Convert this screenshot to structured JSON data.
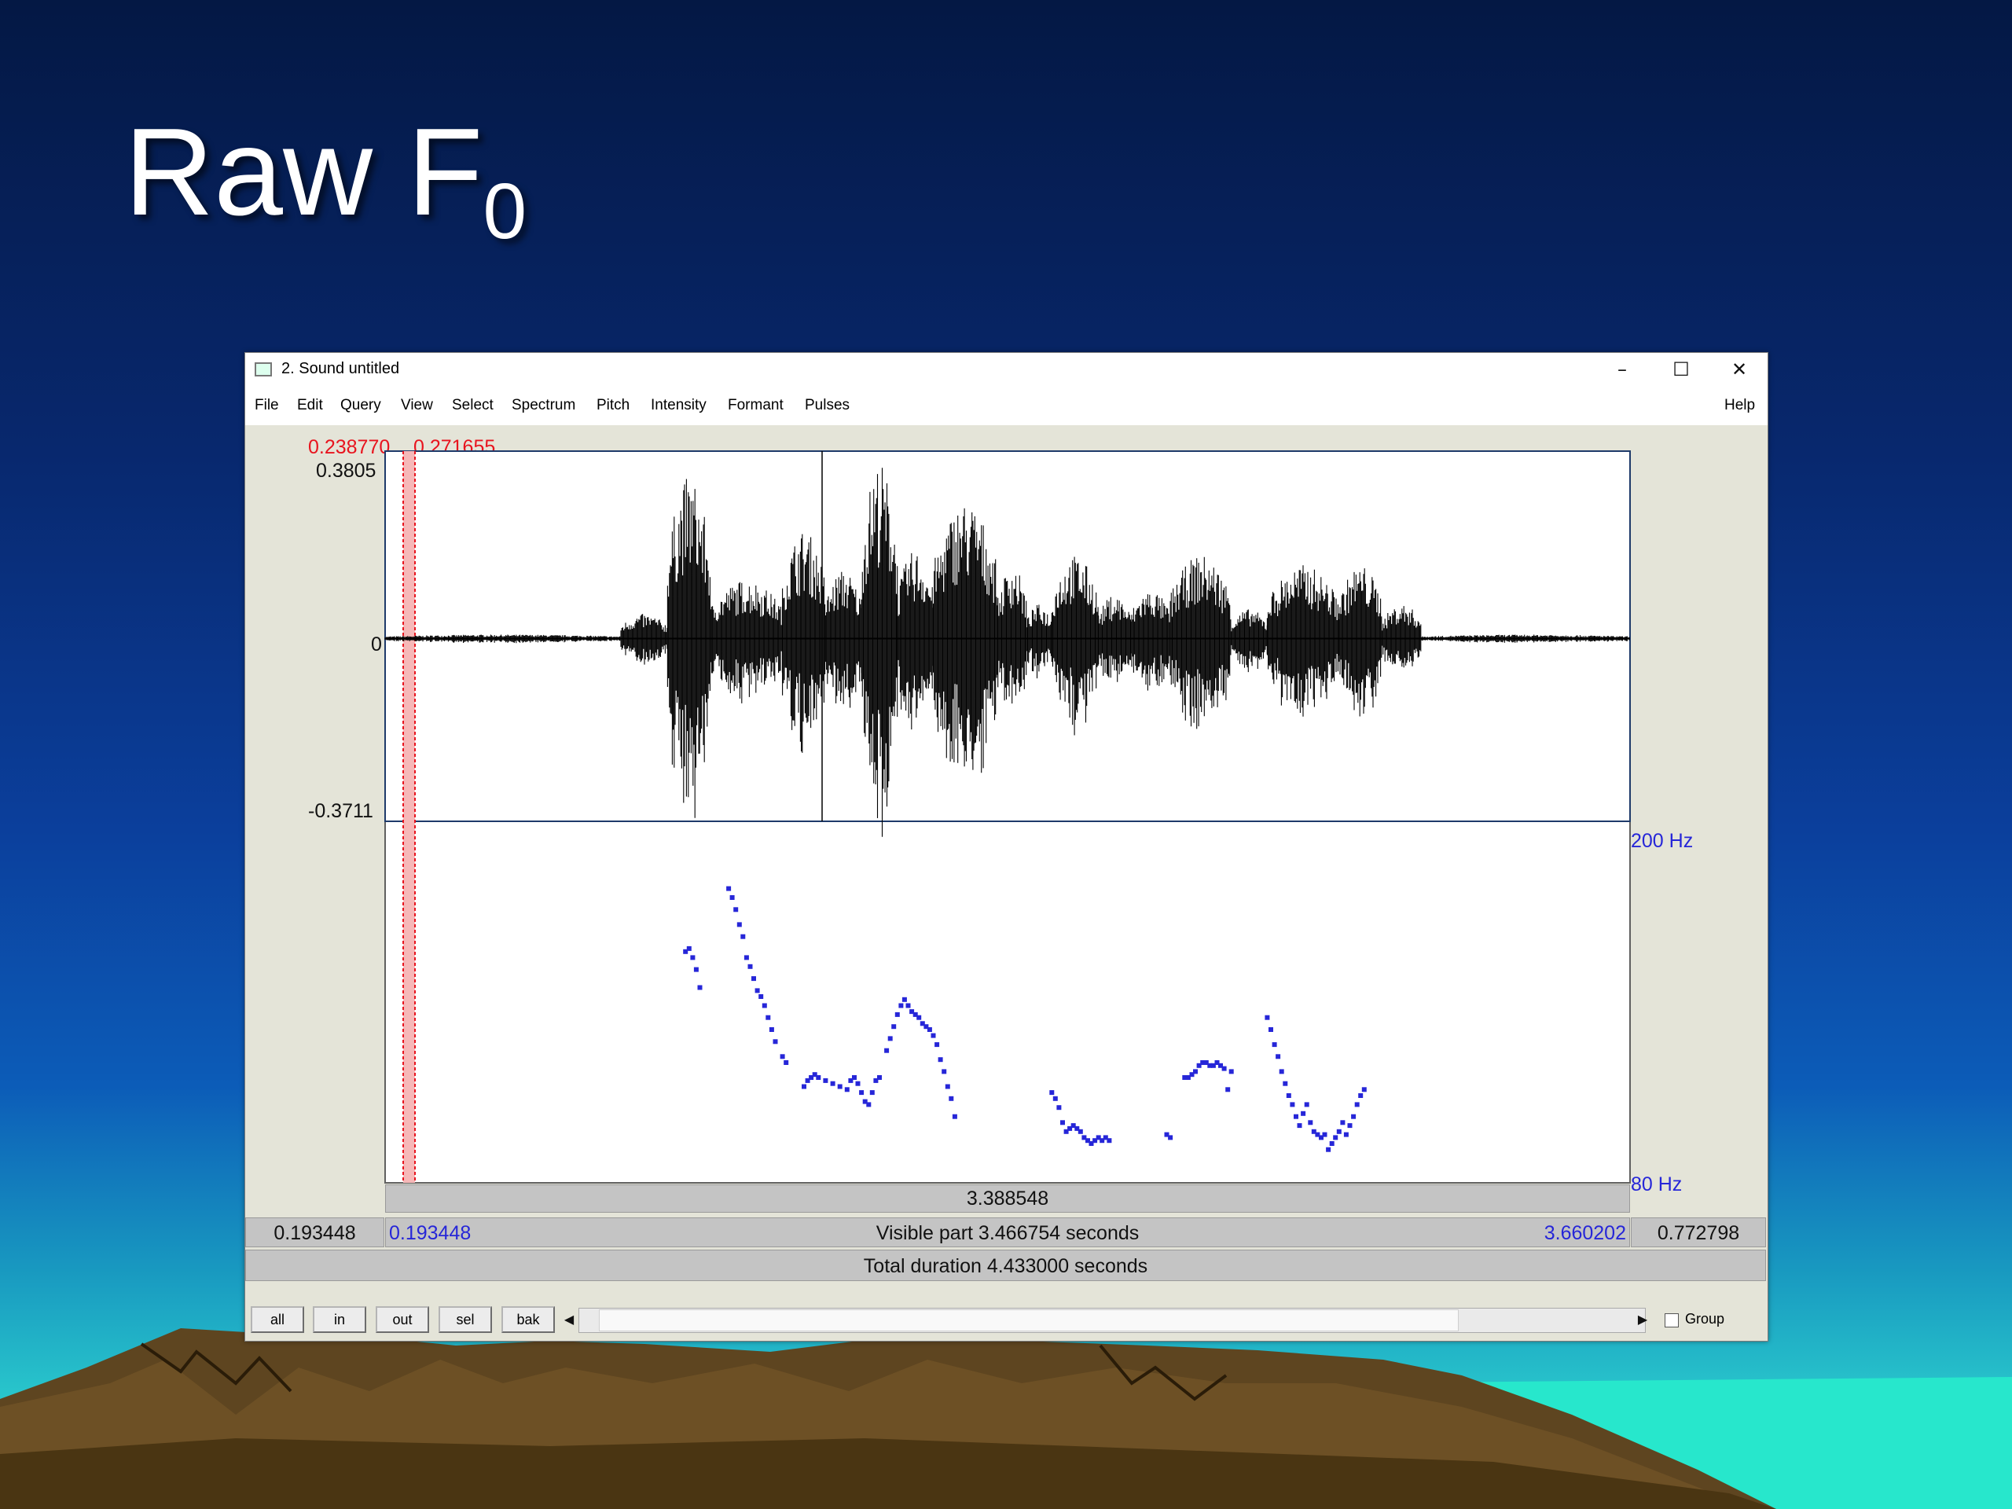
{
  "slide": {
    "title_main": "Raw F",
    "title_sub": "0"
  },
  "window": {
    "title": "2. Sound untitled",
    "controls": {
      "minimize": "–",
      "maximize": "☐",
      "close": "✕"
    },
    "menu": [
      "File",
      "Edit",
      "Query",
      "View",
      "Select",
      "Spectrum",
      "Pitch",
      "Intensity",
      "Formant",
      "Pulses"
    ],
    "help": "Help"
  },
  "editor": {
    "selection_start": "0.238770",
    "selection_end": "0.271655",
    "amplitude_max": "0.3805",
    "amplitude_zero": "0",
    "amplitude_min": "-0.3711",
    "pitch_ceiling": "200 Hz",
    "pitch_floor": "80 Hz",
    "cursor_bar_value": "3.388548",
    "window_left": "0.193448",
    "visible_start": "0.193448",
    "visible_part": "Visible part 3.466754 seconds",
    "visible_end": "3.660202",
    "window_right": "0.772798",
    "total_duration": "Total duration 4.433000 seconds"
  },
  "buttons": {
    "all": "all",
    "in": "in",
    "out": "out",
    "sel": "sel",
    "bak": "bak"
  },
  "group_label": "Group",
  "colors": {
    "selection": "#e8141e",
    "pitch": "#2626d8",
    "waveform": "#000000"
  },
  "chart_data": {
    "type": "scatter",
    "title": "",
    "xlabel": "",
    "ylabel": "",
    "xlim": [
      0.193448,
      3.660202
    ],
    "ylim": [
      80,
      200
    ],
    "waveform": {
      "ylim": [
        -0.3711,
        0.3805
      ],
      "segments": [
        {
          "x0": 0.193448,
          "x1": 0.85,
          "amp": 0.008
        },
        {
          "x0": 0.85,
          "x1": 0.98,
          "amp": 0.05
        },
        {
          "x0": 0.98,
          "x1": 1.1,
          "amp": 0.33
        },
        {
          "x0": 1.1,
          "x1": 1.3,
          "amp": 0.12
        },
        {
          "x0": 1.3,
          "x1": 1.42,
          "amp": 0.22
        },
        {
          "x0": 1.42,
          "x1": 1.52,
          "amp": 0.14
        },
        {
          "x0": 1.52,
          "x1": 1.62,
          "amp": 0.36
        },
        {
          "x0": 1.62,
          "x1": 1.72,
          "amp": 0.18
        },
        {
          "x0": 1.72,
          "x1": 1.9,
          "amp": 0.28
        },
        {
          "x0": 1.9,
          "x1": 1.98,
          "amp": 0.15
        },
        {
          "x0": 1.98,
          "x1": 2.05,
          "amp": 0.07
        },
        {
          "x0": 2.05,
          "x1": 2.18,
          "amp": 0.17
        },
        {
          "x0": 2.18,
          "x1": 2.27,
          "amp": 0.09
        },
        {
          "x0": 2.27,
          "x1": 2.38,
          "amp": 0.1
        },
        {
          "x0": 2.38,
          "x1": 2.55,
          "amp": 0.17
        },
        {
          "x0": 2.55,
          "x1": 2.65,
          "amp": 0.06
        },
        {
          "x0": 2.65,
          "x1": 2.85,
          "amp": 0.15
        },
        {
          "x0": 2.85,
          "x1": 2.97,
          "amp": 0.15
        },
        {
          "x0": 2.97,
          "x1": 3.08,
          "amp": 0.07
        },
        {
          "x0": 3.08,
          "x1": 3.660202,
          "amp": 0.008
        }
      ]
    },
    "pitch_points": [
      {
        "x": 1.03,
        "y": 155
      },
      {
        "x": 1.04,
        "y": 156
      },
      {
        "x": 1.05,
        "y": 153
      },
      {
        "x": 1.06,
        "y": 149
      },
      {
        "x": 1.07,
        "y": 143
      },
      {
        "x": 1.15,
        "y": 176
      },
      {
        "x": 1.16,
        "y": 173
      },
      {
        "x": 1.17,
        "y": 169
      },
      {
        "x": 1.18,
        "y": 164
      },
      {
        "x": 1.19,
        "y": 160
      },
      {
        "x": 1.2,
        "y": 153
      },
      {
        "x": 1.21,
        "y": 150
      },
      {
        "x": 1.22,
        "y": 146
      },
      {
        "x": 1.23,
        "y": 142
      },
      {
        "x": 1.24,
        "y": 140
      },
      {
        "x": 1.25,
        "y": 137
      },
      {
        "x": 1.26,
        "y": 133
      },
      {
        "x": 1.27,
        "y": 129
      },
      {
        "x": 1.28,
        "y": 125
      },
      {
        "x": 1.3,
        "y": 120
      },
      {
        "x": 1.31,
        "y": 118
      },
      {
        "x": 1.36,
        "y": 110
      },
      {
        "x": 1.37,
        "y": 112
      },
      {
        "x": 1.38,
        "y": 113
      },
      {
        "x": 1.39,
        "y": 114
      },
      {
        "x": 1.4,
        "y": 113
      },
      {
        "x": 1.42,
        "y": 112
      },
      {
        "x": 1.44,
        "y": 111
      },
      {
        "x": 1.46,
        "y": 110
      },
      {
        "x": 1.48,
        "y": 109
      },
      {
        "x": 1.49,
        "y": 112
      },
      {
        "x": 1.5,
        "y": 113
      },
      {
        "x": 1.51,
        "y": 111
      },
      {
        "x": 1.52,
        "y": 108
      },
      {
        "x": 1.53,
        "y": 105
      },
      {
        "x": 1.54,
        "y": 104
      },
      {
        "x": 1.55,
        "y": 108
      },
      {
        "x": 1.56,
        "y": 112
      },
      {
        "x": 1.57,
        "y": 113
      },
      {
        "x": 1.59,
        "y": 122
      },
      {
        "x": 1.6,
        "y": 126
      },
      {
        "x": 1.61,
        "y": 130
      },
      {
        "x": 1.62,
        "y": 134
      },
      {
        "x": 1.63,
        "y": 137
      },
      {
        "x": 1.64,
        "y": 139
      },
      {
        "x": 1.65,
        "y": 137
      },
      {
        "x": 1.66,
        "y": 135
      },
      {
        "x": 1.67,
        "y": 134
      },
      {
        "x": 1.68,
        "y": 133
      },
      {
        "x": 1.69,
        "y": 131
      },
      {
        "x": 1.7,
        "y": 130
      },
      {
        "x": 1.71,
        "y": 129
      },
      {
        "x": 1.72,
        "y": 127
      },
      {
        "x": 1.73,
        "y": 124
      },
      {
        "x": 1.74,
        "y": 119
      },
      {
        "x": 1.75,
        "y": 115
      },
      {
        "x": 1.76,
        "y": 110
      },
      {
        "x": 1.77,
        "y": 106
      },
      {
        "x": 1.78,
        "y": 100
      },
      {
        "x": 2.05,
        "y": 108
      },
      {
        "x": 2.06,
        "y": 106
      },
      {
        "x": 2.07,
        "y": 103
      },
      {
        "x": 2.08,
        "y": 98
      },
      {
        "x": 2.09,
        "y": 95
      },
      {
        "x": 2.1,
        "y": 96
      },
      {
        "x": 2.11,
        "y": 97
      },
      {
        "x": 2.12,
        "y": 96
      },
      {
        "x": 2.13,
        "y": 95
      },
      {
        "x": 2.14,
        "y": 93
      },
      {
        "x": 2.15,
        "y": 92
      },
      {
        "x": 2.16,
        "y": 91
      },
      {
        "x": 2.17,
        "y": 92
      },
      {
        "x": 2.18,
        "y": 93
      },
      {
        "x": 2.19,
        "y": 92
      },
      {
        "x": 2.2,
        "y": 93
      },
      {
        "x": 2.21,
        "y": 92
      },
      {
        "x": 2.37,
        "y": 94
      },
      {
        "x": 2.38,
        "y": 93
      },
      {
        "x": 2.42,
        "y": 113
      },
      {
        "x": 2.43,
        "y": 113
      },
      {
        "x": 2.44,
        "y": 114
      },
      {
        "x": 2.45,
        "y": 115
      },
      {
        "x": 2.46,
        "y": 117
      },
      {
        "x": 2.47,
        "y": 118
      },
      {
        "x": 2.48,
        "y": 118
      },
      {
        "x": 2.49,
        "y": 117
      },
      {
        "x": 2.5,
        "y": 117
      },
      {
        "x": 2.51,
        "y": 118
      },
      {
        "x": 2.52,
        "y": 117
      },
      {
        "x": 2.53,
        "y": 116
      },
      {
        "x": 2.54,
        "y": 109
      },
      {
        "x": 2.55,
        "y": 115
      },
      {
        "x": 2.65,
        "y": 133
      },
      {
        "x": 2.66,
        "y": 129
      },
      {
        "x": 2.67,
        "y": 124
      },
      {
        "x": 2.68,
        "y": 120
      },
      {
        "x": 2.69,
        "y": 115
      },
      {
        "x": 2.7,
        "y": 111
      },
      {
        "x": 2.71,
        "y": 107
      },
      {
        "x": 2.72,
        "y": 104
      },
      {
        "x": 2.73,
        "y": 100
      },
      {
        "x": 2.74,
        "y": 97
      },
      {
        "x": 2.75,
        "y": 101
      },
      {
        "x": 2.76,
        "y": 104
      },
      {
        "x": 2.77,
        "y": 98
      },
      {
        "x": 2.78,
        "y": 95
      },
      {
        "x": 2.79,
        "y": 94
      },
      {
        "x": 2.8,
        "y": 93
      },
      {
        "x": 2.81,
        "y": 94
      },
      {
        "x": 2.82,
        "y": 89
      },
      {
        "x": 2.83,
        "y": 91
      },
      {
        "x": 2.84,
        "y": 93
      },
      {
        "x": 2.85,
        "y": 95
      },
      {
        "x": 2.86,
        "y": 98
      },
      {
        "x": 2.87,
        "y": 94
      },
      {
        "x": 2.88,
        "y": 97
      },
      {
        "x": 2.89,
        "y": 100
      },
      {
        "x": 2.9,
        "y": 104
      },
      {
        "x": 2.91,
        "y": 107
      },
      {
        "x": 2.92,
        "y": 109
      }
    ]
  }
}
